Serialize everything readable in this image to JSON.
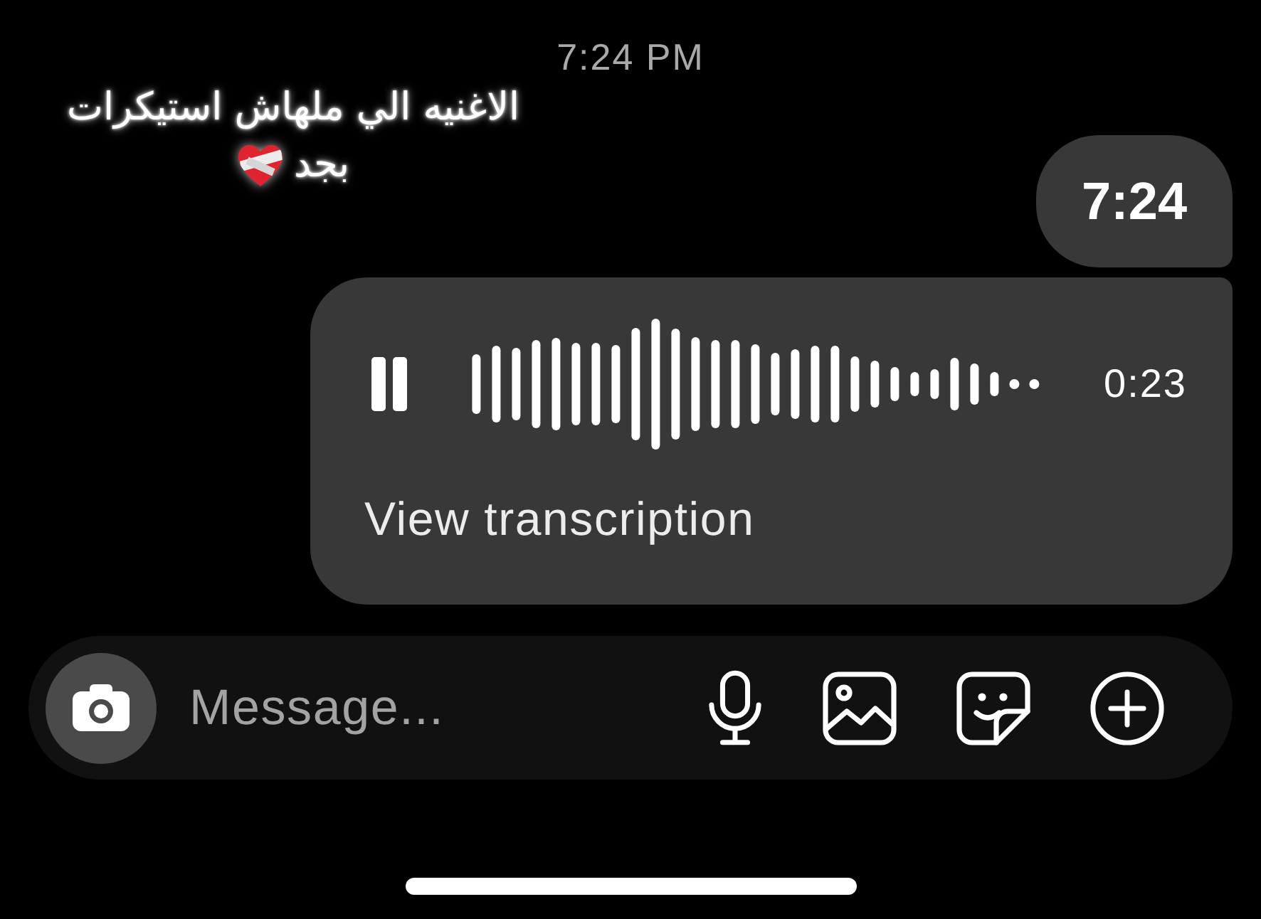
{
  "timestamp": "7:24 PM",
  "caption": {
    "lines": [
      "الاغنيه الي ملهاش استيكرات",
      "بجد"
    ]
  },
  "messages": [
    {
      "kind": "text",
      "text": "7:24"
    },
    {
      "kind": "voice",
      "playing": true,
      "duration": "0:23",
      "link": "View transcription"
    }
  ],
  "composer": {
    "placeholder": "Message..."
  }
}
